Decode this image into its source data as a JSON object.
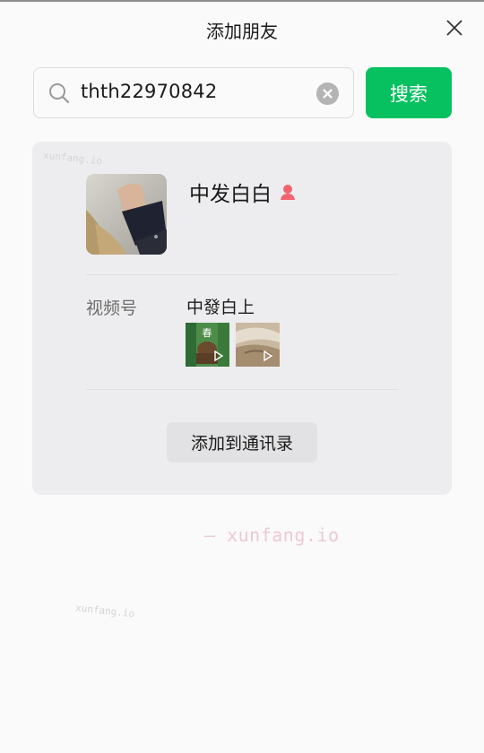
{
  "header": {
    "title": "添加朋友",
    "close_icon": "close-icon"
  },
  "search": {
    "value": "thth22970842",
    "button_label": "搜索",
    "accent_color": "#07c160"
  },
  "result": {
    "nickname": "中发白白",
    "gender_icon": "female-icon",
    "gender_color": "#f06470",
    "channels_label": "视频号",
    "channels_name": "中發白上",
    "thumbnails": [
      {
        "caption": "春",
        "icon": "play-icon"
      },
      {
        "caption": "",
        "icon": "play-icon"
      }
    ],
    "add_button_label": "添加到通讯录"
  },
  "watermarks": {
    "small_1": "xunfang.io",
    "small_2": "xunfang.io",
    "main": "— xunfang.io"
  }
}
